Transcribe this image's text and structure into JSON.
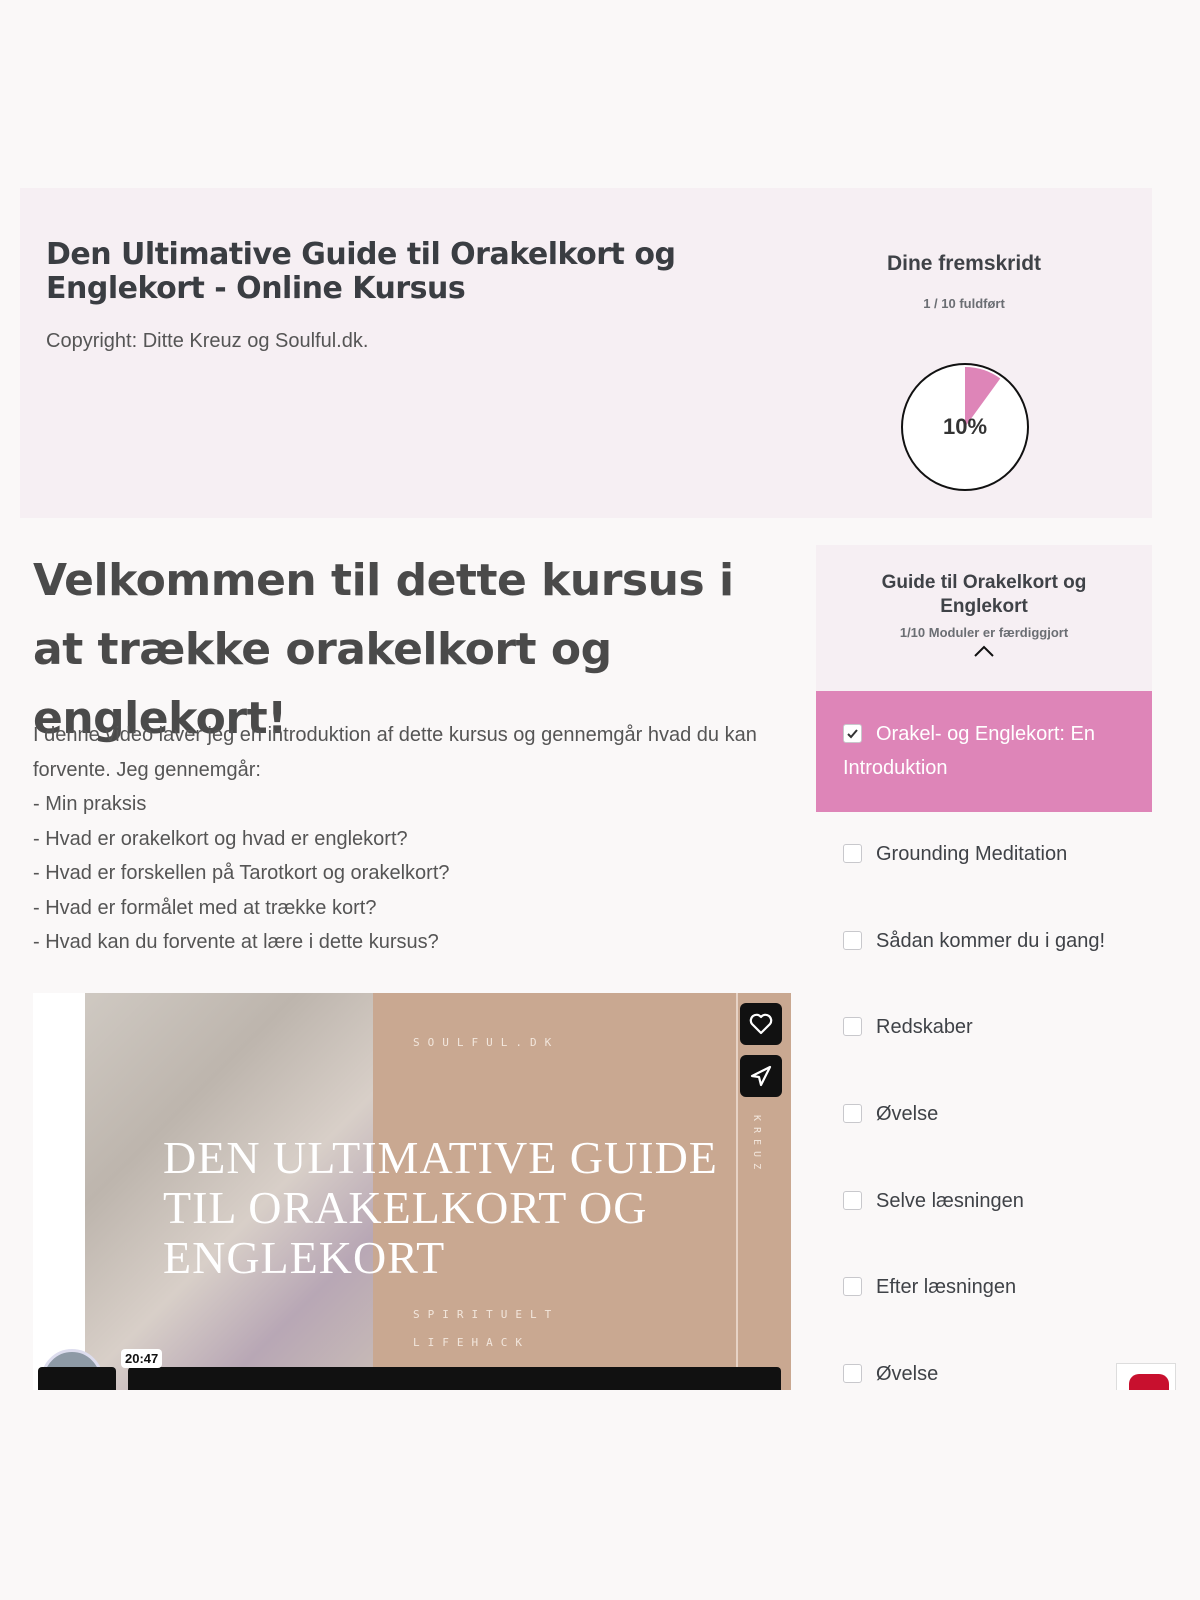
{
  "header": {
    "title": "Den Ultimative Guide til Orakelkort og Englekort - Online Kursus",
    "copyright": "Copyright: Ditte Kreuz og Soulful.dk.",
    "progress_title": "Dine fremskridt",
    "progress_sub": "1 / 10 fuldført",
    "progress_percent_label": "10%",
    "progress_fraction": 0.1,
    "progress_color": "#de85b8"
  },
  "lesson": {
    "heading": "Velkommen til dette kursus i at trække orakelkort og englekort!",
    "intro": "I denne video laver jeg en introduktion af dette kursus og gennemgår hvad du kan forvente. Jeg gennemgår:",
    "bullets": [
      "- Min praksis",
      "- Hvad er orakelkort og hvad er englekort?",
      "- Hvad er forskellen på Tarotkort og orakelkort?",
      "- Hvad er formålet med at trække kort?",
      "- Hvad kan du forvente at lære i dette kursus?"
    ]
  },
  "video": {
    "brand": "SOULFUL.DK",
    "title": "DEN ULTIMATIVE GUIDE TIL ORAKELKORT OG ENGLEKORT",
    "tagline1": "SPIRITUELT",
    "tagline2": "LIFEHACK",
    "side_text": "KREUZ",
    "duration": "20:47"
  },
  "sidebar": {
    "title": "Guide til Orakelkort og Englekort",
    "subtitle": "1/10 Moduler er færdiggjort",
    "active_item": "Orakel- og Englekort: En Introduktion",
    "items": [
      "Grounding Meditation",
      "Sådan kommer du i gang!",
      "Redskaber",
      "Øvelse",
      "Selve læsningen",
      "Efter læsningen",
      "Øvelse"
    ]
  }
}
